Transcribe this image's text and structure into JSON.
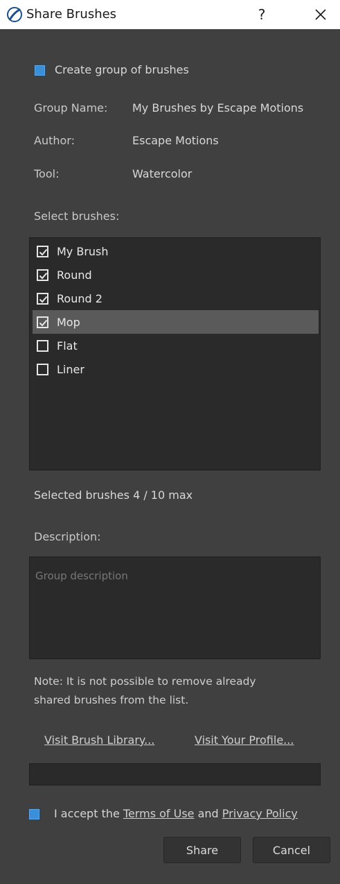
{
  "window": {
    "title": "Share Brushes",
    "help_label": "?",
    "icons": {
      "app": "app-brush-icon",
      "close": "close-icon"
    }
  },
  "form": {
    "create_group_label": "Create group of brushes",
    "create_group_checked": true,
    "group_name_label": "Group Name:",
    "group_name_value": "My Brushes by Escape Motions",
    "author_label": "Author:",
    "author_value": "Escape Motions",
    "tool_label": "Tool:",
    "tool_value": "Watercolor",
    "select_brushes_label": "Select brushes:"
  },
  "brushes": [
    {
      "label": "My Brush",
      "checked": true,
      "selected": false
    },
    {
      "label": "Round",
      "checked": true,
      "selected": false
    },
    {
      "label": "Round 2",
      "checked": true,
      "selected": false
    },
    {
      "label": "Mop",
      "checked": true,
      "selected": true
    },
    {
      "label": "Flat",
      "checked": false,
      "selected": false
    },
    {
      "label": "Liner",
      "checked": false,
      "selected": false
    }
  ],
  "selected_count_text": "Selected brushes 4 / 10 max",
  "description": {
    "label": "Description:",
    "placeholder": "Group description"
  },
  "note": {
    "line1": "Note: It is not possible to remove already",
    "line2": "shared brushes from the list."
  },
  "links": {
    "brush_library": "Visit Brush Library...",
    "profile": "Visit Your Profile..."
  },
  "accept": {
    "checked": true,
    "prefix": "I accept the ",
    "terms": "Terms of Use",
    "middle": " and ",
    "privacy": "Privacy Policy"
  },
  "buttons": {
    "share": "Share",
    "cancel": "Cancel"
  },
  "colors": {
    "dialog_bg": "#404040",
    "list_bg": "#2a2a2a",
    "accent_blue": "#3b8fd9",
    "selected_row": "#5a5a5a"
  }
}
